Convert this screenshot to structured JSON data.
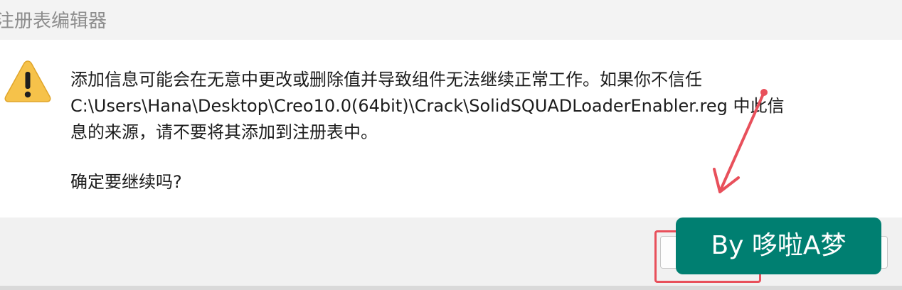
{
  "window": {
    "title": "注册表编辑器"
  },
  "message": {
    "line1": "添加信息可能会在无意中更改或删除值并导致组件无法继续正常工作。如果你不信任",
    "line2": "C:\\Users\\Hana\\Desktop\\Creo10.0(64bit)\\Crack\\SolidSQUADLoaderEnabler.reg 中此信",
    "line3": "息的来源，请不要将其添加到注册表中。",
    "confirm": "确定要继续吗?"
  },
  "icons": {
    "warning": "warning-icon"
  },
  "buttons": {
    "yes_label": "",
    "no_label": ""
  },
  "annotation": {
    "color": "#e8505b"
  },
  "watermark": {
    "text": "By 哆啦A梦",
    "color": "#007f71"
  }
}
